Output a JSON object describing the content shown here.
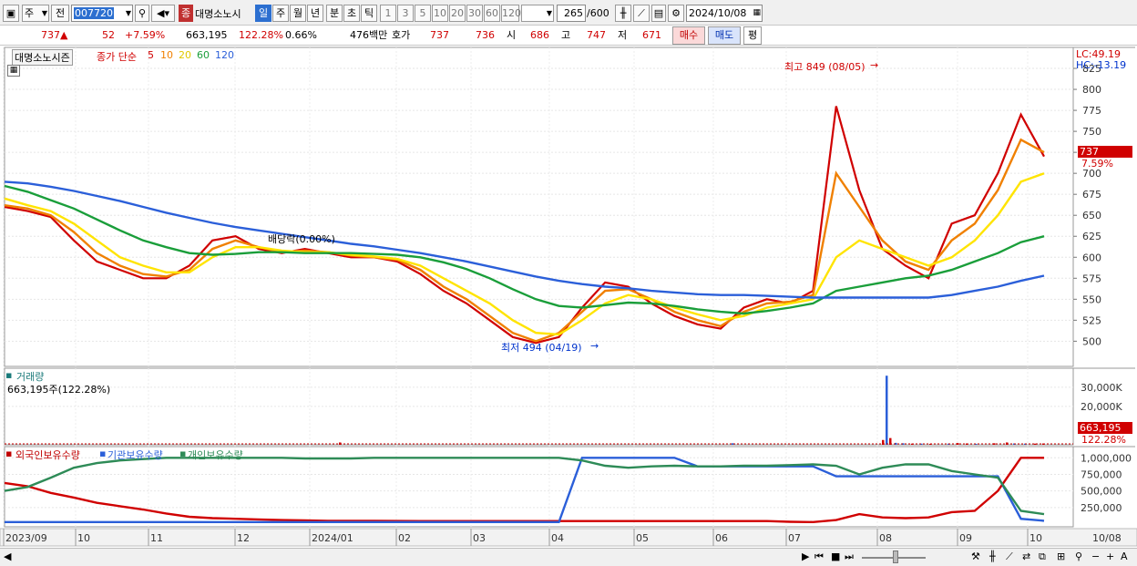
{
  "toolbar": {
    "period_label": "주",
    "prev_label": "전",
    "code_value": "007720",
    "jong_badge": "종",
    "stock_name": "대명소노시",
    "timeframes": [
      "일",
      "주",
      "월",
      "년",
      "분",
      "초",
      "틱"
    ],
    "intervals": [
      "1",
      "3",
      "5",
      "10",
      "20",
      "30",
      "60",
      "120"
    ],
    "count_value": "265",
    "count_max": "/600",
    "date_value": "2024/10/08"
  },
  "quote": {
    "price": "737",
    "change": "52",
    "change_pct": "+7.59%",
    "volume": "663,195",
    "volume_ratio": "122.28%",
    "turnover": "0.66%",
    "amount": "476백만",
    "hoga_label": "호가",
    "ask": "737",
    "bid": "736",
    "open_label": "시",
    "open": "686",
    "high_label": "고",
    "high": "747",
    "low_label": "저",
    "low": "671",
    "buy_label": "매수",
    "sell_label": "매도",
    "avg_label": "평"
  },
  "price_panel": {
    "legend_name": "대명소노시즌",
    "legend_main": "종가 단순",
    "ma_periods": [
      "5",
      "10",
      "20",
      "60",
      "120"
    ],
    "lc": "LC:49.19",
    "hc": "HC:-13.19",
    "current_price_tag": "737",
    "current_pct_tag": "7.59%",
    "high_annotation": "최고 849 (08/05)",
    "low_annotation": "최저 494 (04/19)",
    "dividend_annotation": "배당락(0.00%)"
  },
  "volume_panel": {
    "title": "거래량",
    "subtitle": "663,195주(122.28%)",
    "current_tag": "663,195",
    "ratio_tag": "122.28%"
  },
  "holding_panel": {
    "legend": [
      "외국인보유수량",
      "기관보유수량",
      "개인보유수량"
    ]
  },
  "chart_data": [
    {
      "type": "line",
      "title": "대명소노시즌 종가 단순 5 10 20 60 120",
      "y_ticks": [
        500,
        525,
        550,
        575,
        600,
        625,
        650,
        675,
        700,
        725,
        750,
        775,
        800,
        825
      ],
      "ylim": [
        470,
        850
      ],
      "x_ticks": [
        "2023/09",
        "10",
        "11",
        "12",
        "2024/01",
        "02",
        "03",
        "04",
        "05",
        "06",
        "07",
        "08",
        "09",
        "10",
        "10/08"
      ],
      "series": [
        {
          "name": "5",
          "color": "#d00000",
          "values": [
            660,
            655,
            648,
            620,
            595,
            585,
            575,
            575,
            590,
            620,
            625,
            610,
            605,
            610,
            605,
            600,
            600,
            595,
            580,
            560,
            545,
            525,
            505,
            498,
            505,
            540,
            570,
            565,
            545,
            530,
            520,
            515,
            540,
            550,
            545,
            560,
            780,
            680,
            610,
            590,
            575,
            640,
            650,
            700,
            770,
            720
          ]
        },
        {
          "name": "10",
          "color": "#f08000",
          "values": [
            662,
            658,
            650,
            630,
            605,
            590,
            580,
            577,
            585,
            610,
            620,
            612,
            606,
            608,
            606,
            602,
            600,
            597,
            585,
            565,
            550,
            530,
            510,
            500,
            510,
            535,
            560,
            562,
            550,
            535,
            525,
            518,
            535,
            545,
            547,
            555,
            700,
            660,
            620,
            595,
            585,
            620,
            640,
            680,
            740,
            725
          ]
        },
        {
          "name": "20",
          "color": "#ffe400",
          "values": [
            670,
            662,
            655,
            640,
            620,
            600,
            590,
            582,
            582,
            600,
            612,
            612,
            608,
            606,
            606,
            603,
            601,
            598,
            590,
            575,
            560,
            545,
            525,
            510,
            508,
            525,
            545,
            555,
            550,
            540,
            532,
            525,
            530,
            540,
            545,
            550,
            600,
            620,
            610,
            600,
            590,
            600,
            620,
            650,
            690,
            700
          ]
        },
        {
          "name": "60",
          "color": "#1a9e3a",
          "values": [
            685,
            678,
            668,
            658,
            645,
            632,
            620,
            612,
            605,
            603,
            604,
            606,
            606,
            605,
            605,
            605,
            604,
            603,
            600,
            594,
            586,
            575,
            562,
            550,
            542,
            540,
            543,
            546,
            545,
            542,
            538,
            535,
            533,
            536,
            540,
            545,
            560,
            565,
            570,
            575,
            578,
            585,
            595,
            605,
            618,
            625
          ]
        },
        {
          "name": "120",
          "color": "#2b5fd9",
          "values": [
            690,
            688,
            684,
            679,
            673,
            667,
            660,
            653,
            647,
            641,
            636,
            632,
            628,
            624,
            620,
            616,
            613,
            609,
            605,
            600,
            595,
            589,
            583,
            577,
            572,
            568,
            565,
            563,
            560,
            558,
            556,
            555,
            555,
            554,
            553,
            552,
            552,
            552,
            552,
            552,
            552,
            555,
            560,
            565,
            572,
            578
          ]
        }
      ]
    },
    {
      "type": "bar",
      "title": "거래량",
      "y_ticks": [
        "20,000K",
        "30,000K"
      ],
      "note": "large spike at 08 (~36,000K)"
    },
    {
      "type": "line",
      "title": "외국인보유수량 기관보유수량 개인보유수량",
      "y_ticks": [
        "250,000",
        "500,000",
        "750,000",
        "1,000,000"
      ],
      "ylim": [
        0,
        1100000
      ],
      "series": [
        {
          "name": "외국인보유수량",
          "color": "#d00000",
          "values": [
            620000,
            570000,
            470000,
            400000,
            320000,
            270000,
            220000,
            160000,
            110000,
            90000,
            80000,
            70000,
            60000,
            55000,
            50000,
            50000,
            48000,
            47000,
            46000,
            46000,
            45000,
            45000,
            45000,
            45000,
            45000,
            45000,
            45000,
            45000,
            45000,
            45000,
            45000,
            45000,
            45000,
            45000,
            35000,
            30000,
            60000,
            150000,
            100000,
            90000,
            100000,
            180000,
            200000,
            500000,
            1000000,
            1000000
          ]
        },
        {
          "name": "기관보유수량",
          "color": "#2b5fd9",
          "values": [
            30000,
            30000,
            30000,
            30000,
            30000,
            30000,
            30000,
            30000,
            30000,
            30000,
            30000,
            30000,
            30000,
            30000,
            30000,
            30000,
            30000,
            30000,
            30000,
            30000,
            30000,
            30000,
            30000,
            30000,
            30000,
            1000000,
            1000000,
            1000000,
            1000000,
            1000000,
            870000,
            870000,
            870000,
            870000,
            870000,
            870000,
            720000,
            720000,
            720000,
            720000,
            720000,
            720000,
            720000,
            720000,
            80000,
            50000
          ]
        },
        {
          "name": "개인보유수량",
          "color": "#2e8b57",
          "values": [
            500000,
            560000,
            700000,
            850000,
            920000,
            960000,
            980000,
            1000000,
            1000000,
            1000000,
            1000000,
            1000000,
            1000000,
            990000,
            990000,
            990000,
            1000000,
            1000000,
            1000000,
            1000000,
            1000000,
            1000000,
            1000000,
            1000000,
            1000000,
            960000,
            880000,
            850000,
            870000,
            880000,
            870000,
            870000,
            880000,
            880000,
            890000,
            900000,
            880000,
            750000,
            850000,
            900000,
            900000,
            800000,
            750000,
            700000,
            200000,
            150000
          ]
        }
      ]
    }
  ]
}
